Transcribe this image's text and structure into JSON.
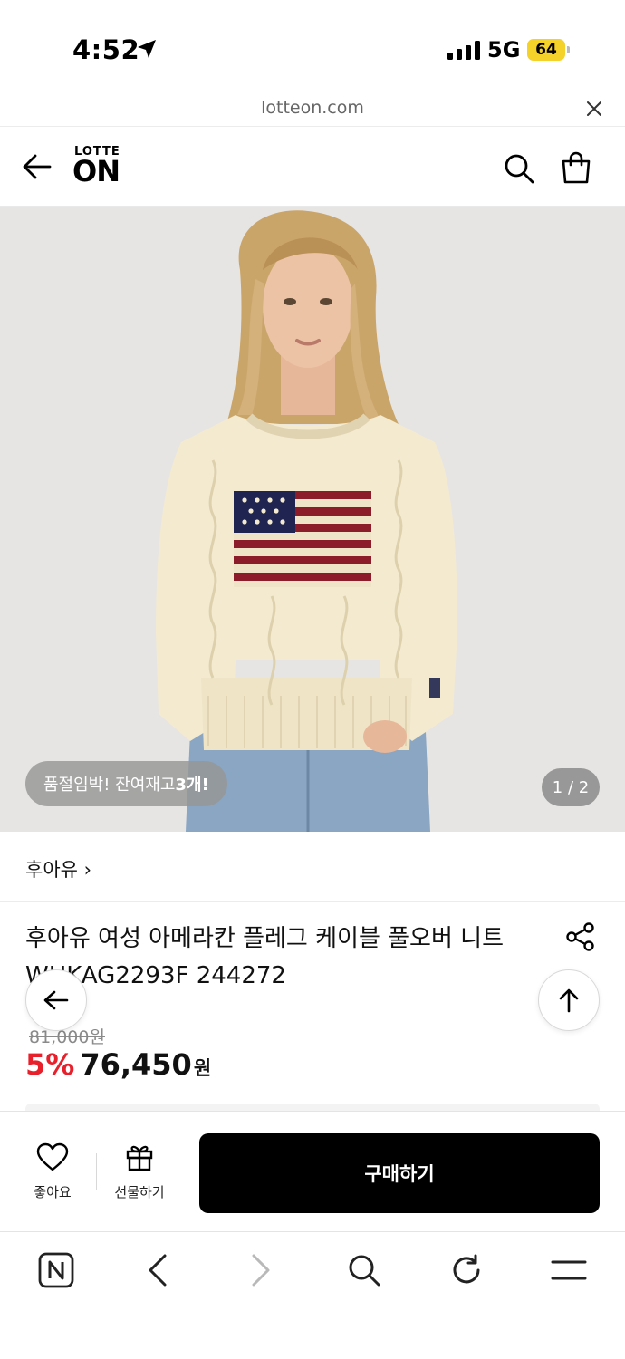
{
  "status_bar": {
    "time": "4:52",
    "network": "5G",
    "battery": "64"
  },
  "url_bar": {
    "domain": "lotteon.com"
  },
  "header": {
    "logo_top": "LOTTE",
    "logo_main": "ON"
  },
  "hero": {
    "stock_prefix": "품절임박! 잔여재고 ",
    "stock_count": "3개!",
    "page_indicator": "1 / 2"
  },
  "product": {
    "brand": "후아유 ›",
    "title": "후아유 여성 아메라칸 플레그 케이블 풀오버 니트 WHKAG2293F 244272",
    "original_price": "81,000원",
    "discount": "5%",
    "price": "76,450",
    "currency": "원"
  },
  "action_bar": {
    "like_label": "좋아요",
    "gift_label": "선물하기",
    "buy_label": "구매하기"
  },
  "icons": [
    "location-arrow-icon",
    "close-icon",
    "back-arrow-icon",
    "search-icon",
    "cart-icon",
    "share-icon",
    "arrow-left-icon",
    "arrow-up-icon",
    "heart-icon",
    "gift-icon",
    "naver-icon",
    "chevron-left-icon",
    "chevron-right-icon",
    "refresh-icon",
    "menu-icon"
  ],
  "colors": {
    "accent_discount": "#e8202c",
    "buy_button": "#000000",
    "battery": "#f4d22a"
  }
}
